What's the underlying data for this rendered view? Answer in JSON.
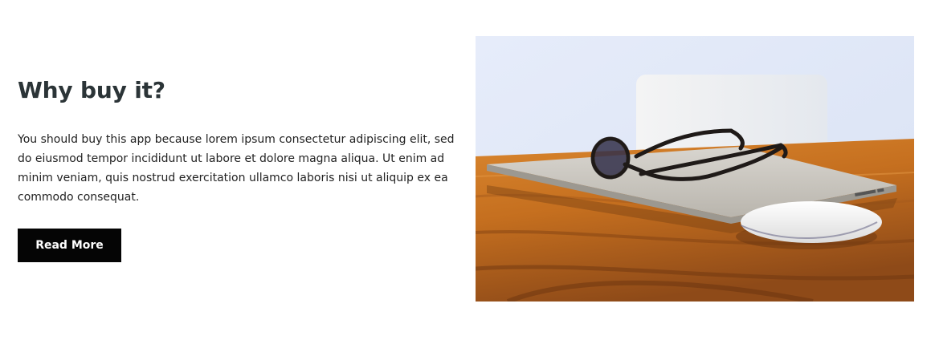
{
  "section": {
    "heading": "Why buy it?",
    "body": "You should buy this app because lorem ipsum consectetur adipiscing elit, sed do eiusmod tempor incididunt ut labore et dolore magna aliqua. Ut enim ad minim veniam, quis nostrud exercitation ullamco laboris nisi ut aliquip ex ea commodo consequat.",
    "button_label": "Read More"
  },
  "colors": {
    "heading": "#2b3437",
    "button_bg": "#050505",
    "button_text": "#ffffff"
  },
  "icons": {
    "photo": "laptop-glasses-mouse-on-wooden-desk-image"
  }
}
